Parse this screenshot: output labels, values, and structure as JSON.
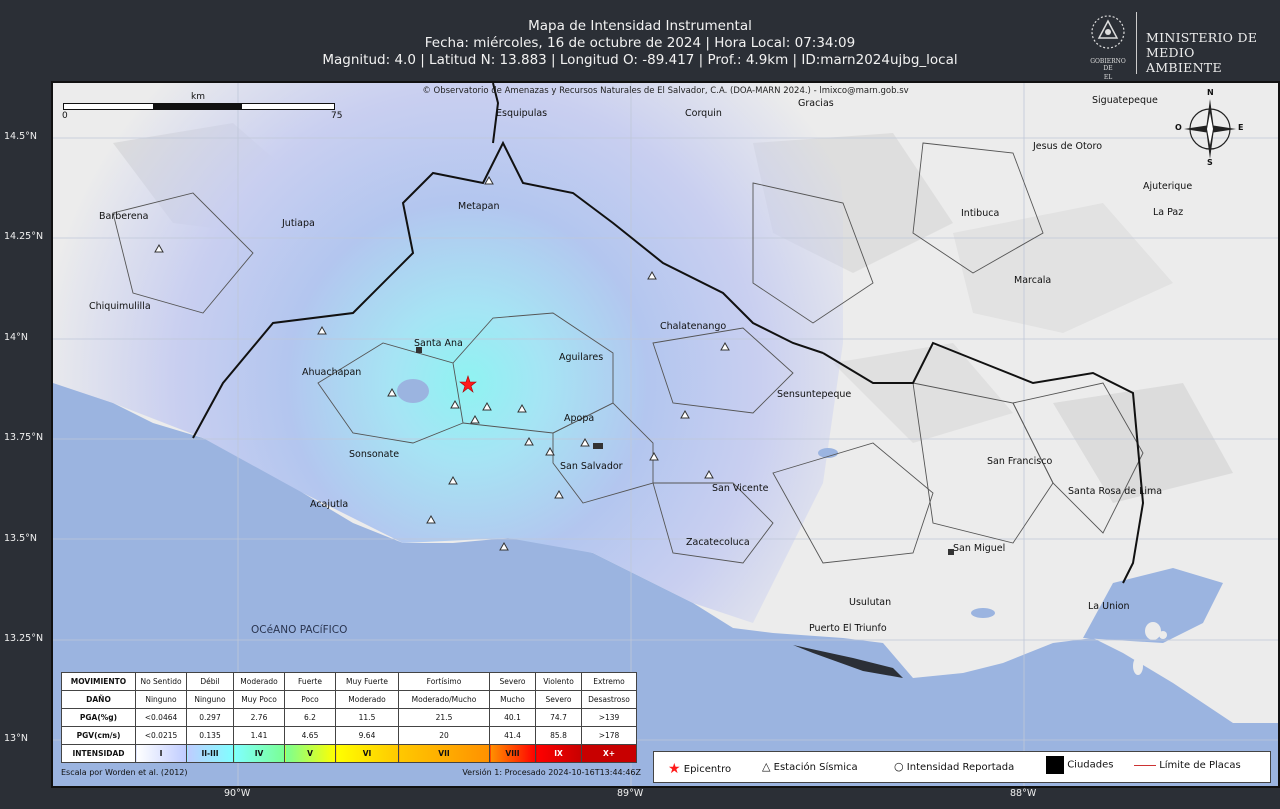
{
  "header": {
    "title": "Mapa de Intensidad Instrumental",
    "line2": "Fecha: miércoles, 16 de octubre de 2024 | Hora Local: 07:34:09",
    "line3": "Magnitud: 4.0 | Latitud N: 13.883 | Longitud O: -89.417 | Prof.: 4.9km | ID:marn2024ujbg_local"
  },
  "ministry": {
    "gov_line1": "GOBIERNO DE",
    "gov_line2": "EL SALVADOR",
    "name_line1": "MINISTERIO DE",
    "name_line2": "MEDIO AMBIENTE"
  },
  "map": {
    "credit": "© Observatorio de Amenazas y Recursos Naturales de El Salvador, C.A. (DOA-MARN 2024.) - lmixco@marn.gob.sv",
    "scale_unit": "km",
    "scale_min": "0",
    "scale_max": "75",
    "compass": {
      "n": "N",
      "s": "S",
      "e": "E",
      "o": "O"
    },
    "ocean_label": "OCéANO PACíFICO",
    "lat_labels": [
      "14.5°N",
      "14.25°N",
      "14°N",
      "13.75°N",
      "13.5°N",
      "13.25°N",
      "13°N"
    ],
    "lon_labels": [
      "90°W",
      "89°W",
      "88°W"
    ],
    "places": [
      "Esquipulas",
      "Corquin",
      "Gracias",
      "Siguatepeque",
      "Jesus de Otoro",
      "Ajuterique",
      "La Paz",
      "Barberena",
      "Jutiapa",
      "Metapan",
      "Intibuca",
      "Marcala",
      "Chiquimulilla",
      "Chalatenango",
      "Santa Ana",
      "Aguilares",
      "Ahuachapan",
      "Sensuntepeque",
      "Apopa",
      "Sonsonate",
      "San Salvador",
      "San Francisco",
      "Santa Rosa de Lima",
      "Acajutla",
      "San Vicente",
      "Zacatecoluca",
      "San Miguel",
      "Usulutan",
      "Puerto El Triunfo",
      "La Union"
    ]
  },
  "intensity_legend": {
    "rows": [
      {
        "label": "MOVIMIENTO",
        "cells": [
          "No Sentido",
          "Débil",
          "Moderado",
          "Fuerte",
          "Muy Fuerte",
          "Fortísimo",
          "Severo",
          "Violento",
          "Extremo"
        ]
      },
      {
        "label": "DAÑO",
        "cells": [
          "Ninguno",
          "Ninguno",
          "Muy Poco",
          "Poco",
          "Moderado",
          "Moderado/Mucho",
          "Mucho",
          "Severo",
          "Desastroso"
        ]
      },
      {
        "label": "PGA(%g)",
        "cells": [
          "<0.0464",
          "0.297",
          "2.76",
          "6.2",
          "11.5",
          "21.5",
          "40.1",
          "74.7",
          ">139"
        ]
      },
      {
        "label": "PGV(cm/s)",
        "cells": [
          "<0.0215",
          "0.135",
          "1.41",
          "4.65",
          "9.64",
          "20",
          "41.4",
          "85.8",
          ">178"
        ]
      }
    ],
    "intensity_label": "INTENSIDAD",
    "intensities": [
      "I",
      "II-III",
      "IV",
      "V",
      "VI",
      "VII",
      "VIII",
      "IX",
      "X+"
    ],
    "intensity_colors": [
      "#ffffff",
      "#bfccff",
      "#80ffff",
      "#7aff93",
      "#ffff00",
      "#ffc800",
      "#ff9100",
      "#ff0000",
      "#c80000"
    ],
    "footer_left": "Escala por Worden et al. (2012)",
    "footer_right": "Versión 1: Procesado 2024-10-16T13:44:46Z"
  },
  "symbol_legend": {
    "epicenter": "Epicentro",
    "station": "Estación Sísmica",
    "reported": "Intensidad Reportada",
    "cities": "Ciudades",
    "plates": "Límite de Placas"
  },
  "colors": {
    "epicenter": "#ff1a1a",
    "ocean": "#9bb4e0",
    "land": "#efefef",
    "intensity_core": "#8ff0f0"
  }
}
